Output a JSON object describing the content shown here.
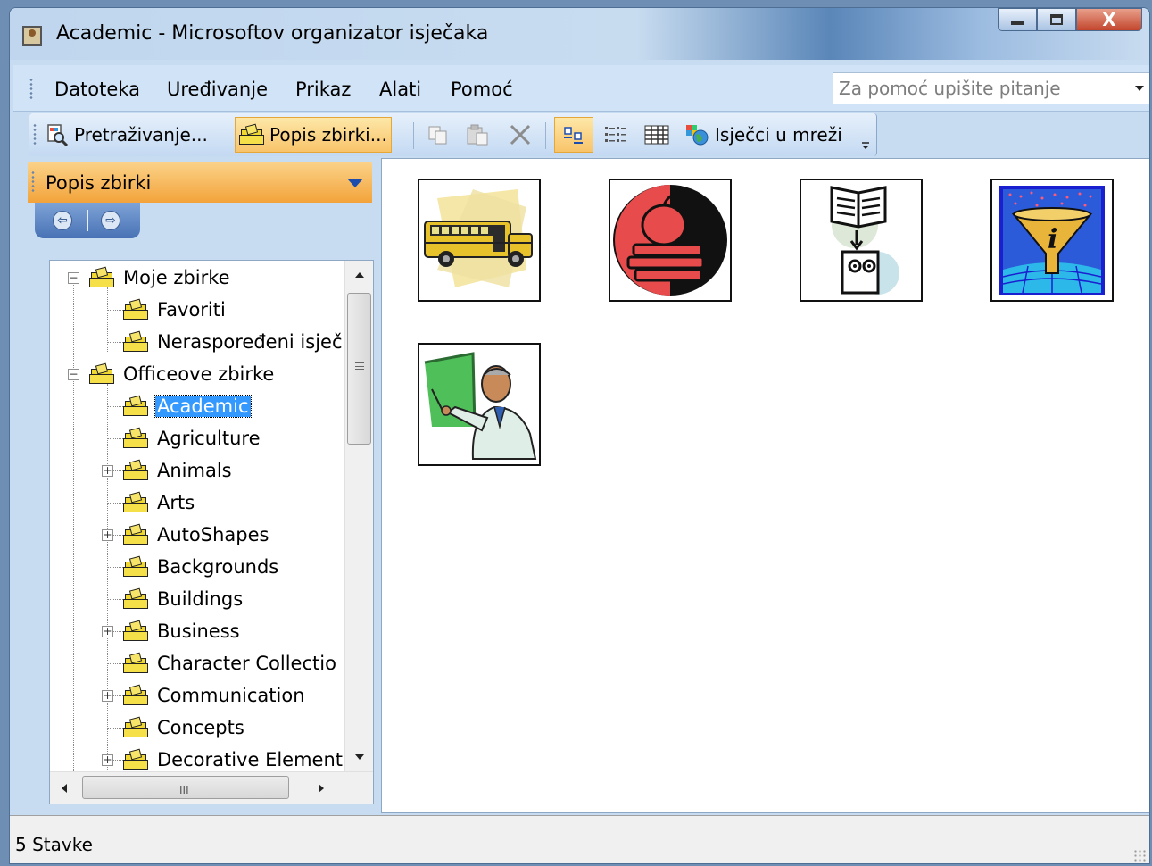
{
  "window": {
    "title": "Academic - Microsoftov organizator isječaka",
    "controls": [
      "minimize",
      "maximize",
      "close"
    ],
    "close_glyph": "X"
  },
  "menubar": {
    "items": [
      "Datoteka",
      "Uređivanje",
      "Prikaz",
      "Alati",
      "Pomoć"
    ],
    "help_placeholder": "Za pomoć upišite pitanje"
  },
  "toolbar": {
    "search_label": "Pretraživanje...",
    "collections_label": "Popis zbirki...",
    "online_clips_label": "Isječci u mreži"
  },
  "taskpane": {
    "title": "Popis zbirki",
    "back_glyph": "⇦",
    "forward_glyph": "⇨"
  },
  "tree": {
    "nodes": [
      {
        "label": "Moje zbirke",
        "level": 0,
        "expander": "−"
      },
      {
        "label": "Favoriti",
        "level": 1
      },
      {
        "label": "Neraspoređeni isječ",
        "level": 1
      },
      {
        "label": "Officeove zbirke",
        "level": 0,
        "expander": "−"
      },
      {
        "label": "Academic",
        "level": 1,
        "selected": true
      },
      {
        "label": "Agriculture",
        "level": 1
      },
      {
        "label": "Animals",
        "level": 1,
        "expander": "+"
      },
      {
        "label": "Arts",
        "level": 1
      },
      {
        "label": "AutoShapes",
        "level": 1,
        "expander": "+"
      },
      {
        "label": "Backgrounds",
        "level": 1
      },
      {
        "label": "Buildings",
        "level": 1
      },
      {
        "label": "Business",
        "level": 1,
        "expander": "+"
      },
      {
        "label": "Character Collectio",
        "level": 1
      },
      {
        "label": "Communication",
        "level": 1,
        "expander": "+"
      },
      {
        "label": "Concepts",
        "level": 1
      },
      {
        "label": "Decorative Element",
        "level": 1,
        "expander": "+"
      }
    ],
    "hscroll_grip": "III"
  },
  "clips": [
    {
      "name": "school-bus-clip"
    },
    {
      "name": "apple-books-clip"
    },
    {
      "name": "book-reader-clip"
    },
    {
      "name": "info-funnel-clip"
    },
    {
      "name": "teacher-clip"
    }
  ],
  "status": {
    "text": "5 Stavke"
  },
  "colors": {
    "selection": "#3399ff",
    "active_button": "#f8c46a",
    "pane_header": "#f3a33a"
  }
}
